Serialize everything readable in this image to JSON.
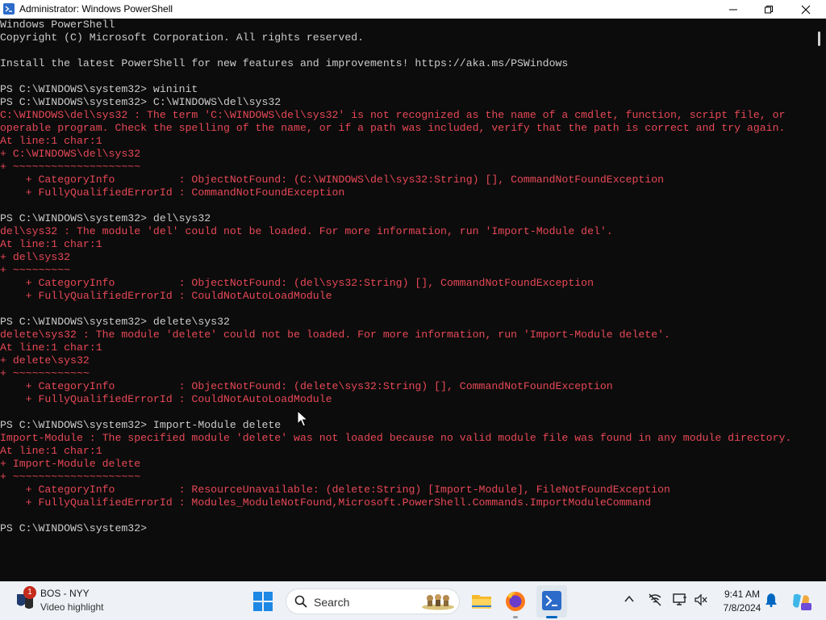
{
  "window": {
    "title": "Administrator: Windows PowerShell",
    "close_icon": "close-icon",
    "min_icon": "minimize-icon",
    "max_icon": "maximize-icon"
  },
  "console": {
    "lines": [
      {
        "t": "Windows PowerShell",
        "k": "normal"
      },
      {
        "t": "Copyright (C) Microsoft Corporation. All rights reserved.",
        "k": "normal"
      },
      {
        "t": "",
        "k": "normal"
      },
      {
        "t": "Install the latest PowerShell for new features and improvements! https://aka.ms/PSWindows",
        "k": "normal"
      },
      {
        "t": "",
        "k": "normal"
      },
      {
        "t": "PS C:\\WINDOWS\\system32> wininit",
        "k": "normal"
      },
      {
        "t": "PS C:\\WINDOWS\\system32> C:\\WINDOWS\\del\\sys32",
        "k": "normal"
      },
      {
        "t": "C:\\WINDOWS\\del\\sys32 : The term 'C:\\WINDOWS\\del\\sys32' is not recognized as the name of a cmdlet, function, script file, or",
        "k": "error"
      },
      {
        "t": "operable program. Check the spelling of the name, or if a path was included, verify that the path is correct and try again.",
        "k": "error"
      },
      {
        "t": "At line:1 char:1",
        "k": "error"
      },
      {
        "t": "+ C:\\WINDOWS\\del\\sys32",
        "k": "error"
      },
      {
        "t": "+ ~~~~~~~~~~~~~~~~~~~~",
        "k": "error"
      },
      {
        "t": "    + CategoryInfo          : ObjectNotFound: (C:\\WINDOWS\\del\\sys32:String) [], CommandNotFoundException",
        "k": "error"
      },
      {
        "t": "    + FullyQualifiedErrorId : CommandNotFoundException",
        "k": "error"
      },
      {
        "t": "",
        "k": "normal"
      },
      {
        "t": "PS C:\\WINDOWS\\system32> del\\sys32",
        "k": "normal"
      },
      {
        "t": "del\\sys32 : The module 'del' could not be loaded. For more information, run 'Import-Module del'.",
        "k": "error"
      },
      {
        "t": "At line:1 char:1",
        "k": "error"
      },
      {
        "t": "+ del\\sys32",
        "k": "error"
      },
      {
        "t": "+ ~~~~~~~~~",
        "k": "error"
      },
      {
        "t": "    + CategoryInfo          : ObjectNotFound: (del\\sys32:String) [], CommandNotFoundException",
        "k": "error"
      },
      {
        "t": "    + FullyQualifiedErrorId : CouldNotAutoLoadModule",
        "k": "error"
      },
      {
        "t": "",
        "k": "normal"
      },
      {
        "t": "PS C:\\WINDOWS\\system32> delete\\sys32",
        "k": "normal"
      },
      {
        "t": "delete\\sys32 : The module 'delete' could not be loaded. For more information, run 'Import-Module delete'.",
        "k": "error"
      },
      {
        "t": "At line:1 char:1",
        "k": "error"
      },
      {
        "t": "+ delete\\sys32",
        "k": "error"
      },
      {
        "t": "+ ~~~~~~~~~~~~",
        "k": "error"
      },
      {
        "t": "    + CategoryInfo          : ObjectNotFound: (delete\\sys32:String) [], CommandNotFoundException",
        "k": "error"
      },
      {
        "t": "    + FullyQualifiedErrorId : CouldNotAutoLoadModule",
        "k": "error"
      },
      {
        "t": "",
        "k": "normal"
      },
      {
        "t": "PS C:\\WINDOWS\\system32> Import-Module delete",
        "k": "normal"
      },
      {
        "t": "Import-Module : The specified module 'delete' was not loaded because no valid module file was found in any module directory.",
        "k": "error"
      },
      {
        "t": "At line:1 char:1",
        "k": "error"
      },
      {
        "t": "+ Import-Module delete",
        "k": "error"
      },
      {
        "t": "+ ~~~~~~~~~~~~~~~~~~~~",
        "k": "error"
      },
      {
        "t": "    + CategoryInfo          : ResourceUnavailable: (delete:String) [Import-Module], FileNotFoundException",
        "k": "error"
      },
      {
        "t": "    + FullyQualifiedErrorId : Modules_ModuleNotFound,Microsoft.PowerShell.Commands.ImportModuleCommand",
        "k": "error"
      },
      {
        "t": "",
        "k": "normal"
      },
      {
        "t": "PS C:\\WINDOWS\\system32>",
        "k": "normal"
      }
    ]
  },
  "taskbar": {
    "widget": {
      "badge": "1",
      "title": "BOS - NYY",
      "subtitle": "Video highlight"
    },
    "search": {
      "label": "Search"
    },
    "clock": {
      "time": "9:41 AM",
      "date": "7/8/2024"
    }
  },
  "colors": {
    "console_bg": "#0c0c0c",
    "console_text": "#cccccc",
    "error_text": "#e74856",
    "taskbar_bg": "#eef2f7",
    "accent": "#0067c0"
  }
}
